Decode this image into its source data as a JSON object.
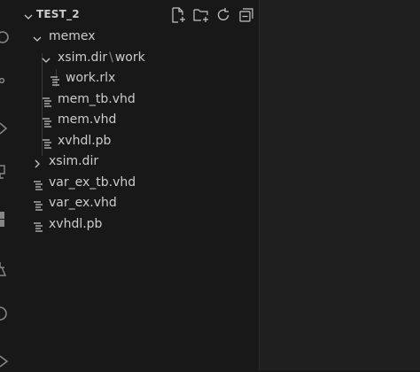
{
  "explorer": {
    "title": "TEST_2",
    "toolbar": {
      "new_file_icon": "new-file-icon",
      "new_folder_icon": "new-folder-icon",
      "refresh_icon": "refresh-icon",
      "collapse_icon": "collapse-all-icon"
    },
    "tree": [
      {
        "label": "memex",
        "kind": "folder-open",
        "depth": 0
      },
      {
        "label_a": "xsim.dir",
        "sep": "\\",
        "label_b": "work",
        "kind": "folder-open",
        "depth": 1
      },
      {
        "label": "work.rlx",
        "kind": "file",
        "depth": 2
      },
      {
        "label": "mem_tb.vhd",
        "kind": "file",
        "depth": 1
      },
      {
        "label": "mem.vhd",
        "kind": "file",
        "depth": 1
      },
      {
        "label": "xvhdl.pb",
        "kind": "file",
        "depth": 1
      },
      {
        "label": "xsim.dir",
        "kind": "folder-closed",
        "depth": 0
      },
      {
        "label": "var_ex_tb.vhd",
        "kind": "file",
        "depth": 0
      },
      {
        "label": "var_ex.vhd",
        "kind": "file",
        "depth": 0
      },
      {
        "label": "xvhdl.pb",
        "kind": "file",
        "depth": 0
      }
    ]
  },
  "colors": {
    "background": "#181818",
    "editor": "#1f1f1f",
    "text": "#cccccc",
    "icon": "#c5c5c5"
  }
}
